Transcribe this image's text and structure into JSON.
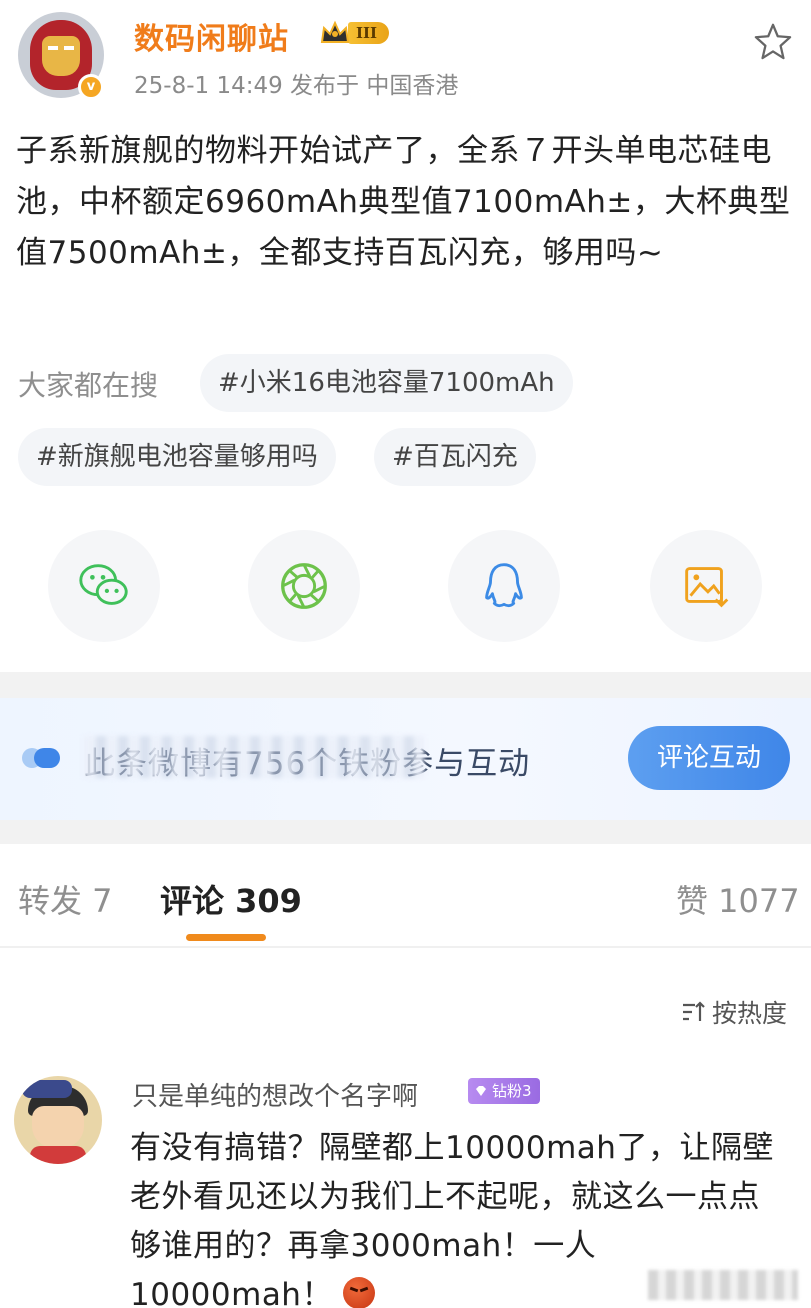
{
  "post": {
    "author": "数码闲聊站",
    "level_badge": "III",
    "meta": "25-8-1 14:49  发布于 中国香港",
    "text": "子系新旗舰的物料开始试产了，全系７开头单电芯硅电池，中杯额定6960mAh典型值7100mAh±，大杯典型值7500mAh±，全都支持百瓦闪充，够用吗~"
  },
  "search": {
    "label": "大家都在搜",
    "tags": [
      "#小米16电池容量7100mAh",
      "#新旗舰电池容量够用吗",
      "#百瓦闪充"
    ]
  },
  "share": {
    "icons": [
      "wechat-icon",
      "moments-icon",
      "qq-icon",
      "save-image-icon"
    ],
    "colors": {
      "wechat": "#3fc05a",
      "moments": "#6dc24b",
      "qq": "#3c8be6",
      "save": "#f0a21e"
    }
  },
  "banner": {
    "text": "此条微博有756个铁粉参与互动",
    "button": "评论互动"
  },
  "tabs": {
    "repost": "转发 7",
    "comments": "评论 309",
    "likes": "赞 1077"
  },
  "sort": {
    "label": "按热度"
  },
  "comment": {
    "user": "只是单纯的想改个名字啊",
    "badge": "钻粉3",
    "text": "有没有搞错？隔壁都上10000mah了，让隔壁老外看见还以为我们上不起呢，就这么一点点够谁用的？再拿3000mah！一人10000mah！"
  },
  "colors": {
    "accent": "#f08a1c",
    "link_blue": "#3f86e8"
  }
}
